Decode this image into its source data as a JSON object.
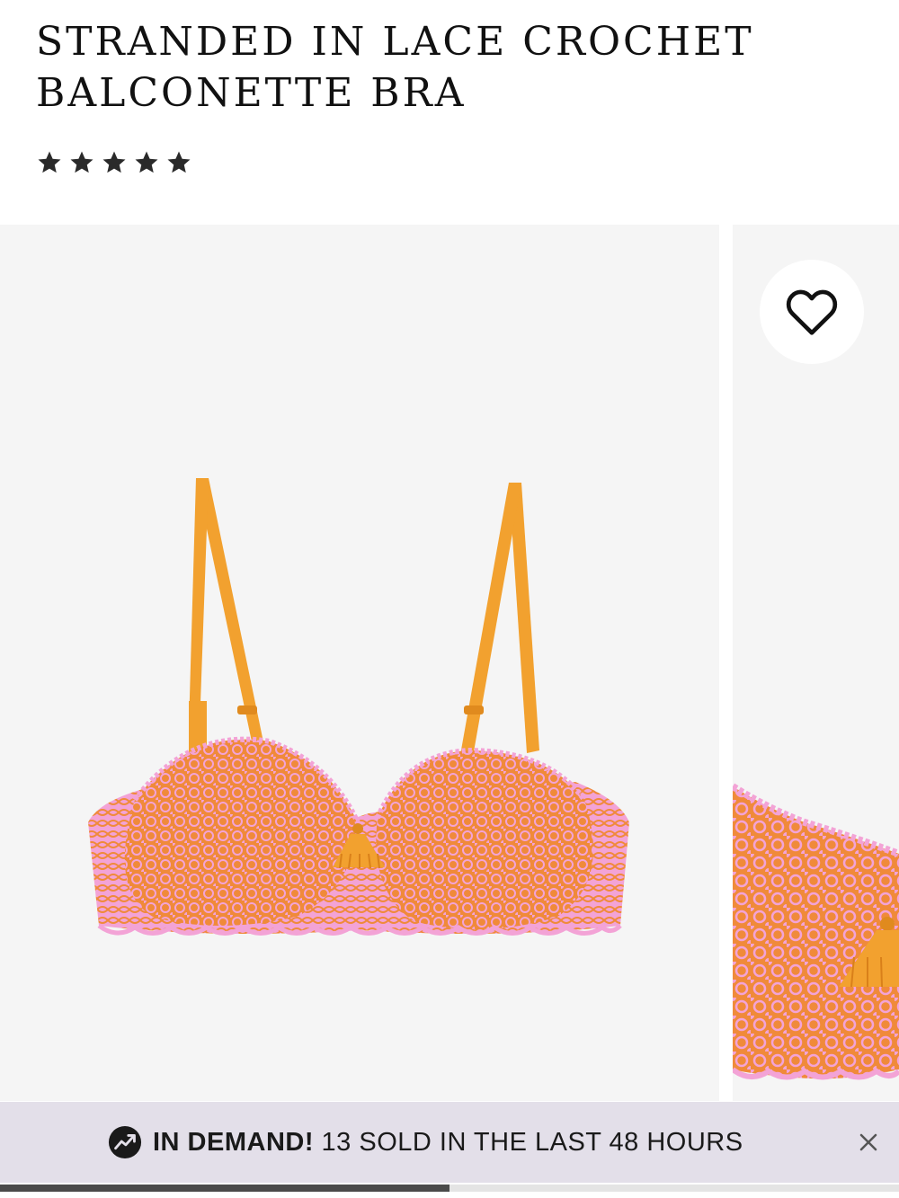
{
  "product": {
    "title": "STRANDED IN LACE CROCHET BALCONETTE BRA",
    "rating_stars": 5
  },
  "gallery": {
    "images_visible": 2,
    "slide_progress": 0.5
  },
  "wishlist": {
    "icon": "heart-icon"
  },
  "banner": {
    "icon": "trending-up-icon",
    "highlight": "IN DEMAND!",
    "message": " 13 SOLD IN THE LAST 48 HOURS",
    "close_icon": "close-icon"
  },
  "colors": {
    "strap": "#f2a12f",
    "lace_orange": "#f08a3a",
    "lace_pink": "#f3a3d6",
    "banner_bg": "#e3dfe9",
    "image_bg": "#f5f5f5"
  }
}
